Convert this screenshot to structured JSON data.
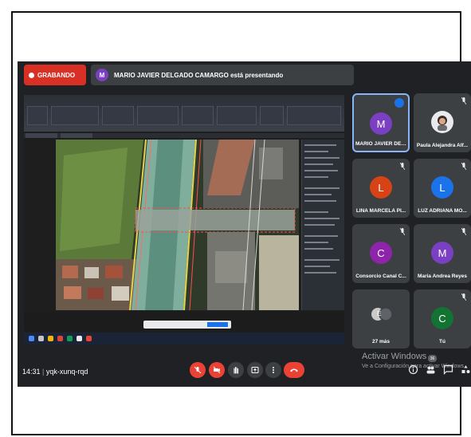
{
  "recording": {
    "label": "GRABANDO"
  },
  "presenter": {
    "initial": "M",
    "banner": "MARIO JAVIER DELGADO CAMARGO está presentando",
    "avatar_color": "#7b3fc4"
  },
  "participants": [
    {
      "name": "MARIO JAVIER DEL...",
      "initial": "M",
      "color": "#7b3fc4",
      "speaking": true
    },
    {
      "name": "Paula Alejandra Alf...",
      "initial": "",
      "color": "#e8eaed",
      "photo": true
    },
    {
      "name": "LINA MARCELA PI...",
      "initial": "L",
      "color": "#d84315"
    },
    {
      "name": "LUZ ADRIANA MO...",
      "initial": "L",
      "color": "#1a73e8"
    },
    {
      "name": "Consorcio Canal C...",
      "initial": "C",
      "color": "#8e24aa"
    },
    {
      "name": "Maria Andrea Reyes",
      "initial": "M",
      "color": "#7b3fc4"
    },
    {
      "name": "27 más",
      "initial": "E",
      "color": "#5f6368"
    },
    {
      "name": "Tú",
      "initial": "C",
      "color": "#137333"
    }
  ],
  "meeting": {
    "time": "14:31",
    "code": "yqk-xunq-rqd"
  },
  "windows_notice": {
    "title": "Activar Windows",
    "subtitle": "Ve a Configuración para activar Windows."
  },
  "participant_count_badge": "36",
  "icons": {
    "mic_off": "mic-off-icon",
    "cam_off": "camera-off-icon",
    "hand": "raise-hand-icon",
    "present": "present-icon",
    "more": "more-options-icon",
    "end": "end-call-icon",
    "info": "info-icon",
    "people": "people-icon",
    "chat": "chat-icon",
    "activities": "activities-icon"
  },
  "colors": {
    "recording": "#d93025",
    "end_call": "#ea4335",
    "background": "#202124",
    "accent": "#8ab4f8"
  }
}
